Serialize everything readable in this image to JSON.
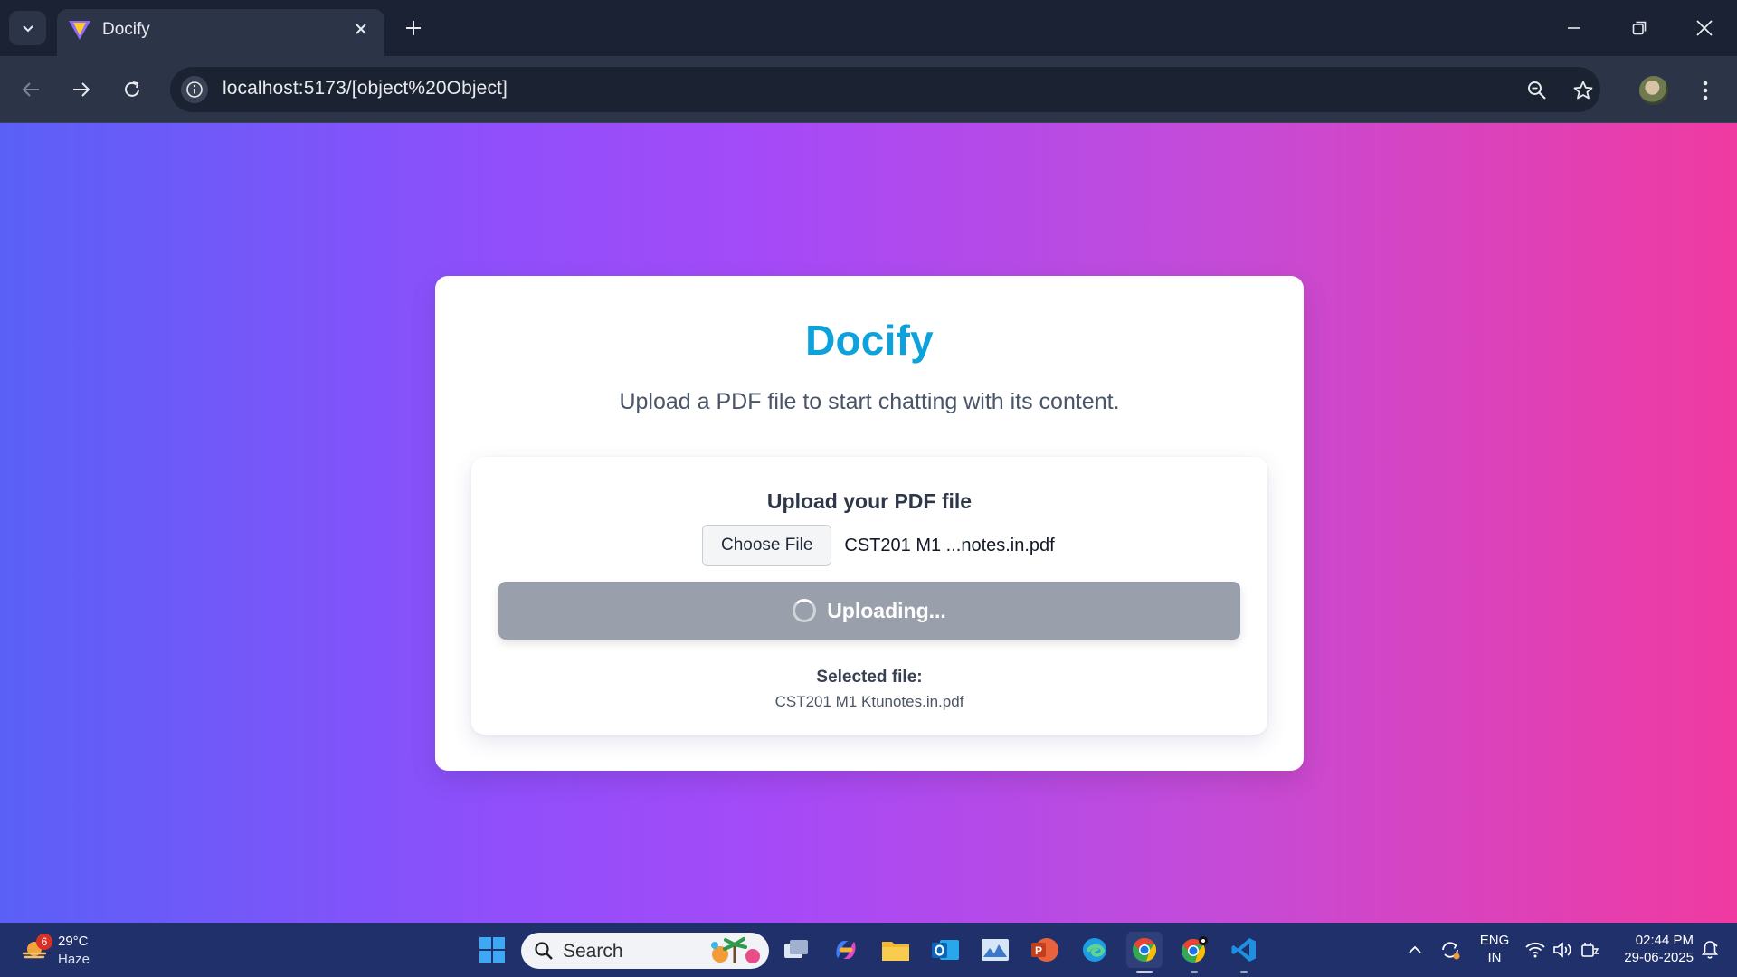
{
  "browser": {
    "tab_title": "Docify",
    "url_host": "localhost",
    "url_rest": ":5173/[object%20Object]"
  },
  "page": {
    "brand": "Docify",
    "subtitle": "Upload a PDF file to start chatting with its content.",
    "upload_panel": {
      "title": "Upload your PDF file",
      "choose_button_label": "Choose File",
      "chosen_file_display": "CST201 M1 ...notes.in.pdf",
      "upload_button_label": "Uploading...",
      "selected_label": "Selected file:",
      "selected_value": "CST201 M1 Ktunotes.in.pdf"
    },
    "colors": {
      "brand": "#0ea2dc",
      "button_disabled": "#9aa0ab",
      "gradient_start": "#5a60f6",
      "gradient_end": "#f03aa1"
    }
  },
  "taskbar": {
    "weather": {
      "temp": "29°C",
      "condition": "Haze",
      "badge": "6"
    },
    "search_placeholder": "Search",
    "lang_line1": "ENG",
    "lang_line2": "IN",
    "time": "02:44 PM",
    "date": "29-06-2025",
    "pinned_icons": [
      "file-explorer-icon",
      "copilot-icon",
      "folder-icon",
      "outlook-icon",
      "photos-icon",
      "powerpoint-icon",
      "edge-icon",
      "chrome-icon",
      "chrome-profile-icon",
      "vscode-icon"
    ]
  }
}
